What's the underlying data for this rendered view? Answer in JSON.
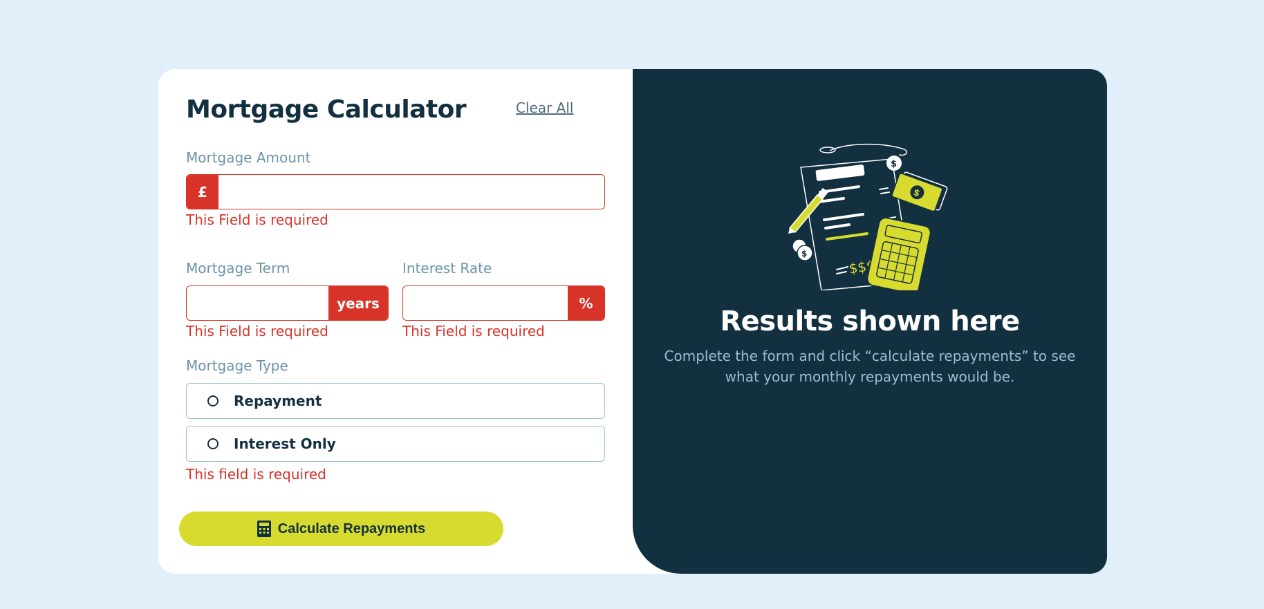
{
  "colors": {
    "background": "#e0eff9",
    "dark": "#133040",
    "lime": "#d8db2f",
    "error": "#d73328",
    "muted": "#6b94a8",
    "border": "#9abed5"
  },
  "form": {
    "title": "Mortgage Calculator",
    "clear_all": "Clear All",
    "amount": {
      "label": "Mortgage Amount",
      "prefix": "£",
      "value": "",
      "error": "This Field is required"
    },
    "term": {
      "label": "Mortgage Term",
      "suffix": "years",
      "value": "",
      "error": "This Field is required"
    },
    "rate": {
      "label": "Interest Rate",
      "suffix": "%",
      "value": "",
      "error": "This Field is required"
    },
    "type": {
      "label": "Mortgage Type",
      "options": [
        "Repayment",
        "Interest Only"
      ],
      "error": "This field is required"
    },
    "submit": {
      "label": "Calculate Repayments",
      "icon": "calculator-icon"
    }
  },
  "results": {
    "illustration": "empty-results-illustration",
    "title": "Results shown here",
    "description": "Complete the form and click “calculate repayments” to see what your monthly repayments would be."
  }
}
